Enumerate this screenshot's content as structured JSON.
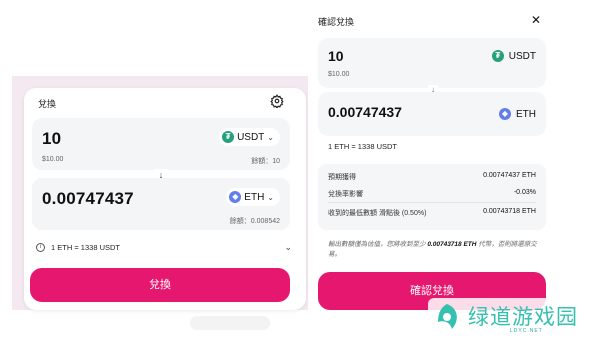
{
  "left_panel": {
    "title": "兌換",
    "from": {
      "amount": "10",
      "usd": "$10.00",
      "token": "USDT",
      "balance": "餘額：10"
    },
    "to": {
      "amount": "0.00747437",
      "token": "ETH",
      "balance": "餘額：0.008542"
    },
    "rate": "1 ETH = 1338 USDT",
    "action_label": "兌換"
  },
  "right_panel": {
    "title": "確認兌換",
    "from": {
      "amount": "10",
      "usd": "$10.00",
      "token": "USDT"
    },
    "to": {
      "amount": "0.00747437",
      "token": "ETH"
    },
    "rate": "1 ETH = 1338 USDT",
    "details": [
      {
        "label": "預期獲得",
        "value": "0.00747437 ETH"
      },
      {
        "label": "兌換率影響",
        "value": "-0.03%"
      },
      {
        "label": "收到的最低數額 滑點後 (0.50%)",
        "value": "0.00743718 ETH"
      }
    ],
    "note_prefix": "輸出數額僅為估值，您將收到至少 ",
    "note_amount": "0.00743718 ETH",
    "note_suffix": " 代幣，否則將還原交易。",
    "confirm_label": "確認兌換"
  },
  "watermark": {
    "text": "绿道游戏园",
    "sub": "LDYC.NET"
  },
  "colors": {
    "accent": "#e6176f",
    "usdt": "#26a17b",
    "eth": "#627eea",
    "watermark": "#36c0b0"
  }
}
